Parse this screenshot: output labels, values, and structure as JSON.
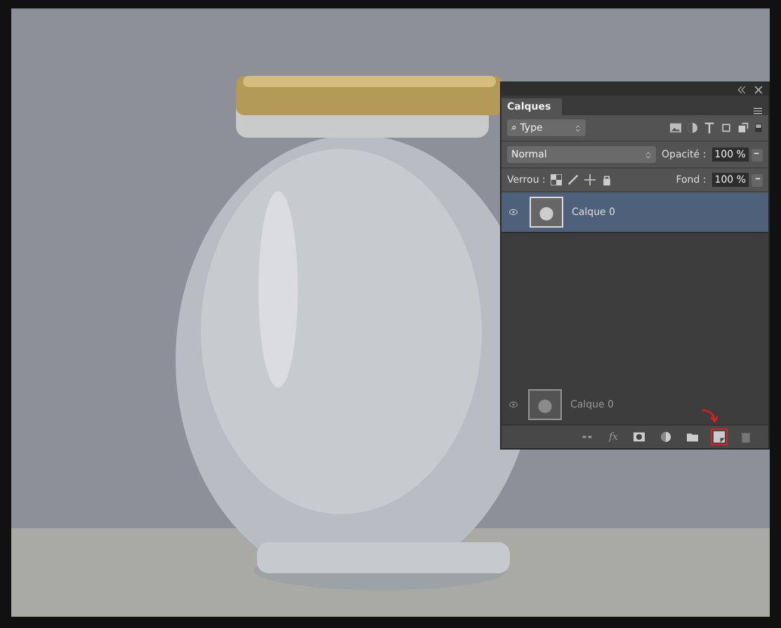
{
  "panel": {
    "tab": "Calques",
    "filter": {
      "label": "Type",
      "glyph": "⌕"
    },
    "blend_mode": "Normal",
    "opacity": {
      "label": "Opacité :",
      "value": "100 %"
    },
    "lock": {
      "label": "Verrou :"
    },
    "fill": {
      "label": "Fond :",
      "value": "100 %"
    },
    "layers": [
      {
        "name": "Calque 0",
        "visible": true,
        "selected": true
      }
    ],
    "drag_preview": {
      "name": "Calque 0"
    },
    "footer": [
      {
        "kind": "link",
        "highlighted": false
      },
      {
        "kind": "fx",
        "text": "fx",
        "highlighted": false
      },
      {
        "kind": "mask",
        "highlighted": false
      },
      {
        "kind": "adjust",
        "highlighted": false
      },
      {
        "kind": "folder",
        "highlighted": false
      },
      {
        "kind": "new",
        "highlighted": true
      },
      {
        "kind": "trash",
        "highlighted": false
      }
    ]
  }
}
